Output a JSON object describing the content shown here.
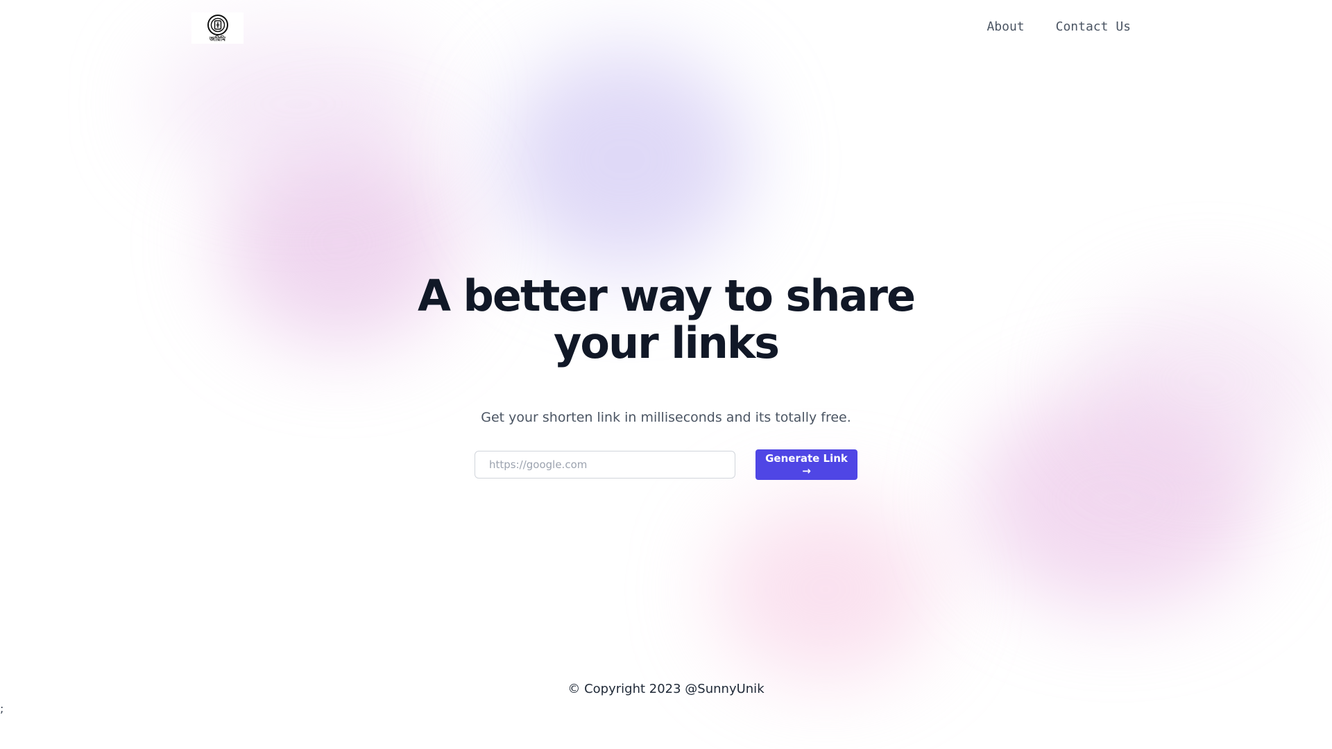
{
  "header": {
    "logo_icon": "logo-emblem-icon",
    "logo_caption": "জরিমি",
    "nav": [
      {
        "label": "About"
      },
      {
        "label": "Contact Us"
      }
    ]
  },
  "hero": {
    "headline_line1": "A better way to share",
    "headline_line2": "your links",
    "subtitle": "Get your shorten link in milliseconds and its totally free.",
    "input": {
      "placeholder": "https://google.com",
      "value": ""
    },
    "button_label": "Generate Link →"
  },
  "footer": {
    "copyright": "© Copyright 2023 @SunnyUnik"
  },
  "stray_text": ";",
  "colors": {
    "accent": "#4f46e5",
    "heading": "#111827",
    "muted": "#4b5563"
  }
}
